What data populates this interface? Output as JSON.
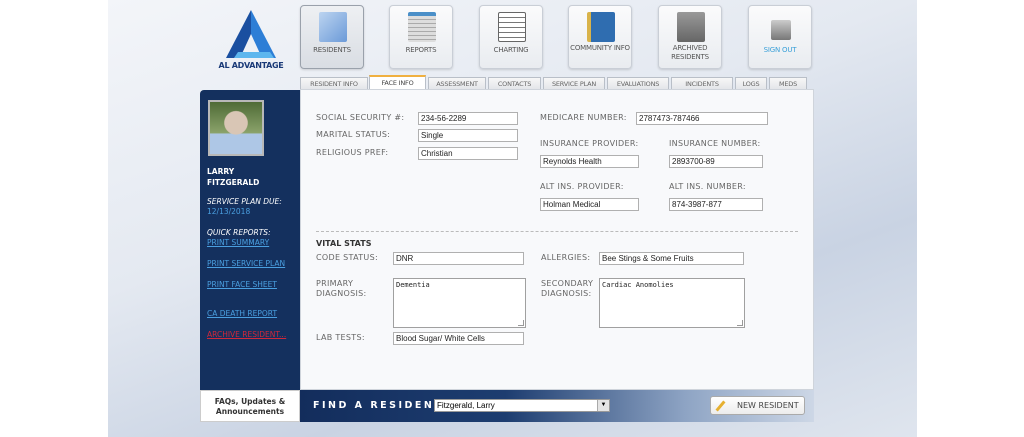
{
  "brand": {
    "name": "AL ADVANTAGE",
    "color": "#1a5fb4"
  },
  "nav": [
    {
      "label": "RESIDENTS",
      "icon": "folder-icon",
      "active": true
    },
    {
      "label": "REPORTS",
      "icon": "report-icon"
    },
    {
      "label": "CHARTING",
      "icon": "clipboard-icon"
    },
    {
      "label": "COMMUNITY INFO",
      "icon": "info-book-icon"
    },
    {
      "label": "ARCHIVED RESIDENTS",
      "icon": "file-cabinet-icon"
    },
    {
      "label": "SIGN OUT",
      "icon": "lock-icon"
    }
  ],
  "tabs": [
    "RESIDENT INFO",
    "FACE INFO",
    "ASSESSMENT",
    "CONTACTS",
    "SERVICE PLAN",
    "EVALUATIONS",
    "INCIDENTS",
    "LOGS",
    "MEDS"
  ],
  "active_tab": "FACE INFO",
  "sidebar": {
    "name_line1": "LARRY",
    "name_line2": "FITZGERALD",
    "service_plan_label": "SERVICE PLAN DUE:",
    "service_plan_date": "12/13/2018",
    "quick_reports_label": "QUICK REPORTS:",
    "links": [
      "PRINT SUMMARY",
      "PRINT SERVICE PLAN",
      "PRINT FACE SHEET",
      "CA DEATH REPORT"
    ],
    "archive_link": "ARCHIVE RESIDENT...",
    "faq_line1": "FAQs, Updates &",
    "faq_line2": "Announcements"
  },
  "form": {
    "ssn": {
      "label": "SOCIAL SECURITY #:",
      "value": "234-56-2289"
    },
    "marital": {
      "label": "MARITAL STATUS:",
      "value": "Single"
    },
    "religious": {
      "label": "RELIGIOUS PREF:",
      "value": "Christian"
    },
    "medicare": {
      "label": "MEDICARE NUMBER:",
      "value": "2787473-787466"
    },
    "ins_provider": {
      "label": "INSURANCE PROVIDER:",
      "value": "Reynolds Health"
    },
    "ins_number": {
      "label": "INSURANCE NUMBER:",
      "value": "2893700-89"
    },
    "alt_provider": {
      "label": "ALT INS. PROVIDER:",
      "value": "Holman Medical"
    },
    "alt_number": {
      "label": "ALT INS. NUMBER:",
      "value": "874-3987-877"
    },
    "vital_heading": "VITAL STATS",
    "code_status": {
      "label": "CODE STATUS:",
      "value": "DNR"
    },
    "allergies": {
      "label": "ALLERGIES:",
      "value": "Bee Stings & Some Fruits"
    },
    "primary": {
      "label1": "PRIMARY",
      "label2": "DIAGNOSIS:",
      "value": "Dementia"
    },
    "secondary": {
      "label1": "SECONDARY",
      "label2": "DIAGNOSIS:",
      "value": "Cardiac Anomolies"
    },
    "lab": {
      "label": "LAB TESTS:",
      "value": "Blood Sugar/ White Cells"
    }
  },
  "bottom": {
    "find_label": "FIND A RESIDENT:",
    "selected": "Fitzgerald, Larry",
    "new_button": "NEW RESIDENT"
  }
}
